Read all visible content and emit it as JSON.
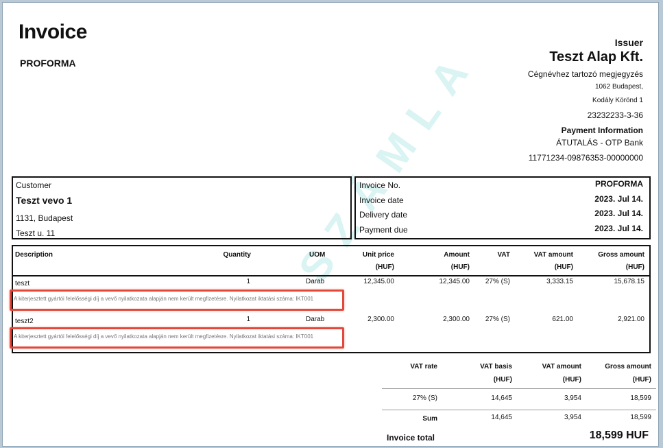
{
  "header": {
    "title": "Invoice",
    "subtitle": "PROFORMA"
  },
  "issuer": {
    "label": "Issuer",
    "name": "Teszt Alap Kft.",
    "note": "Cégnévhez tartozó megjegyzés",
    "address1": "1062 Budapest,",
    "address2": "Kodály Körönd 1",
    "tax_number": "23232233-3-36",
    "payment_label": "Payment Information",
    "payment_method": "ÁTUTALÁS - OTP Bank",
    "account": "11771234-09876353-00000000"
  },
  "customer": {
    "label": "Customer",
    "name": "Teszt vevo 1",
    "address1": "1131, Budapest",
    "address2": "Teszt u. 11"
  },
  "meta": {
    "invoice_no_label": "Invoice No.",
    "invoice_no": "PROFORMA",
    "invoice_date_label": "Invoice date",
    "invoice_date": "2023. Jul 14.",
    "delivery_date_label": "Delivery date",
    "delivery_date": "2023. Jul 14.",
    "payment_due_label": "Payment due",
    "payment_due": "2023. Jul 14."
  },
  "items_header": {
    "description": "Description",
    "quantity": "Quantity",
    "uom": "UOM",
    "unit_price": "Unit price",
    "unit_price_cur": "(HUF)",
    "amount": "Amount",
    "amount_cur": "(HUF)",
    "vat": "VAT",
    "vat_amount": "VAT amount",
    "vat_amount_cur": "(HUF)",
    "gross_amount": "Gross amount",
    "gross_amount_cur": "(HUF)"
  },
  "items": [
    {
      "description": "teszt",
      "quantity": "1",
      "uom": "Darab",
      "unit_price": "12,345.00",
      "amount": "12,345.00",
      "vat": "27% (S)",
      "vat_amount": "3,333.15",
      "gross_amount": "15,678.15",
      "note": "A kiterjesztett gyártói felelősségi díj a vevő nyilatkozata alapján nem került megfizetésre. Nyilatkozat iktatási száma: IKT001"
    },
    {
      "description": "teszt2",
      "quantity": "1",
      "uom": "Darab",
      "unit_price": "2,300.00",
      "amount": "2,300.00",
      "vat": "27% (S)",
      "vat_amount": "621.00",
      "gross_amount": "2,921.00",
      "note": "A kiterjesztett gyártói felelősségi díj a vevő nyilatkozata alapján nem került megfizetésre. Nyilatkozat iktatási száma: IKT001"
    }
  ],
  "watermark": "SZÁMLA",
  "summary_header": {
    "vat_rate": "VAT rate",
    "vat_basis": "VAT basis",
    "vat_basis_cur": "(HUF)",
    "vat_amount": "VAT amount",
    "vat_amount_cur": "(HUF)",
    "gross_amount": "Gross amount",
    "gross_amount_cur": "(HUF)"
  },
  "summary_row": {
    "vat_rate": "27% (S)",
    "vat_basis": "14,645",
    "vat_amount": "3,954",
    "gross_amount": "18,599"
  },
  "summary_sum": {
    "label": "Sum",
    "vat_basis": "14,645",
    "vat_amount": "3,954",
    "gross_amount": "18,599"
  },
  "total": {
    "label": "Invoice total",
    "value": "18,599 HUF"
  }
}
